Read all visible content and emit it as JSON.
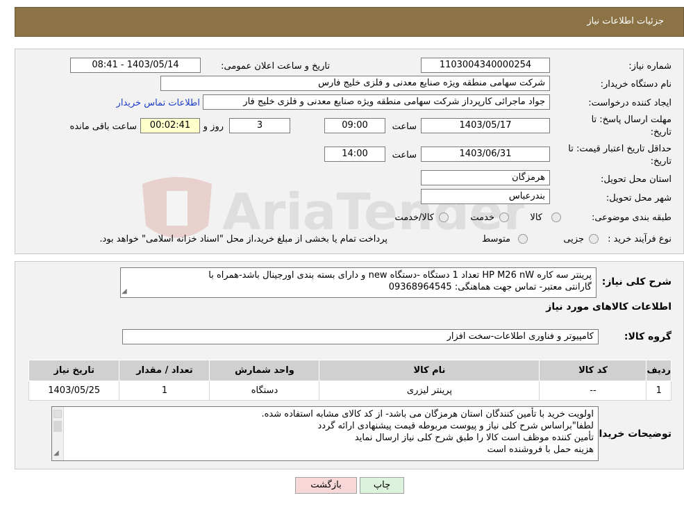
{
  "header": {
    "title": "جزئیات اطلاعات نیاز"
  },
  "form": {
    "need_no_label": "شماره نیاز:",
    "need_no": "1103004340000254",
    "announce_label": "تاریخ و ساعت اعلان عمومی:",
    "announce_value": "1403/05/14 - 08:41",
    "buyer_label": "نام دستگاه خریدار:",
    "buyer_value": "شرکت سهامی منطقه ویژه صنایع معدنی و فلزی خلیج فارس",
    "creator_label": "ایجاد کننده درخواست:",
    "creator_value": "جواد ماجرائی کارپرداز شرکت سهامی منطقه ویژه صنایع معدنی و فلزی خلیج فار",
    "contact_link": "اطلاعات تماس خریدار",
    "deadline_label_1": "مهلت ارسال پاسخ: تا",
    "deadline_label_2": "تاریخ:",
    "deadline_date": "1403/05/17",
    "time_label": "ساعت",
    "deadline_time": "09:00",
    "days_value": "3",
    "days_label": "روز و",
    "remaining_value": "00:02:41",
    "remaining_label": "ساعت باقی مانده",
    "validity_label_1": "حداقل تاریخ اعتبار قیمت: تا",
    "validity_label_2": "تاریخ:",
    "validity_date": "1403/06/31",
    "validity_time": "14:00",
    "province_label": "استان محل تحویل:",
    "province_value": "هرمزگان",
    "city_label": "شهر محل تحویل:",
    "city_value": "بندرعباس",
    "category_label": "طبقه بندی موضوعی:",
    "category_opt1": "کالا",
    "category_opt2": "خدمت",
    "category_opt3": "کالا/خدمت",
    "process_label": "نوع فرآیند خرید :",
    "process_opt1": "جزیی",
    "process_opt2": "متوسط",
    "process_note": "پرداخت تمام یا بخشی از مبلغ خرید،از محل \"اسناد خزانه اسلامی\" خواهد بود."
  },
  "need_section": {
    "summary_label": "شرح کلی نیاز:",
    "summary_line1": "پرینتر سه کاره   HP  M26 nW تعداد 1 دستگاه -دستگاه new و دارای بسته بندی اورجینال باشد-همراه با",
    "summary_line2": "گارانتی معتبر- تماس جهت هماهنگی: 09368964545",
    "goods_info_title": "اطلاعات کالاهای مورد نیاز",
    "group_label": "گروه کالا:",
    "group_value": "کامپیوتر و فناوری اطلاعات-سخت افزار"
  },
  "table": {
    "headers": [
      "ردیف",
      "کد کالا",
      "نام کالا",
      "واحد شمارش",
      "تعداد / مقدار",
      "تاریخ نیاز"
    ],
    "rows": [
      [
        "1",
        "--",
        "پرینتر لیزری",
        "دستگاه",
        "1",
        "1403/05/25"
      ]
    ]
  },
  "notes": {
    "label": "توضیحات خریدار:",
    "line1": "اولویت خرید با تأمین کنندگان استان هرمزگان می باشد- از کد کالای مشابه استفاده شده.",
    "line2": "لطفا\"براساس شرح کلی نیاز و پیوست مربوطه قیمت پیشنهادی ارائه گردد",
    "line3": "تأمین کننده موظف است کالا را طبق شرح کلی نیاز ارسال نماید",
    "line4": "هزینه حمل با فروشنده است"
  },
  "buttons": {
    "back": "بازگشت",
    "print": "چاپ"
  },
  "watermark": {
    "text": "AriaTender.neT"
  },
  "colors": {
    "header_bg": "#8b7346",
    "link": "#1a3cc8",
    "remaining_bg": "#ffffcc",
    "back_button_bg": "#f7d7d7",
    "print_button_bg": "#ddf2dd"
  }
}
